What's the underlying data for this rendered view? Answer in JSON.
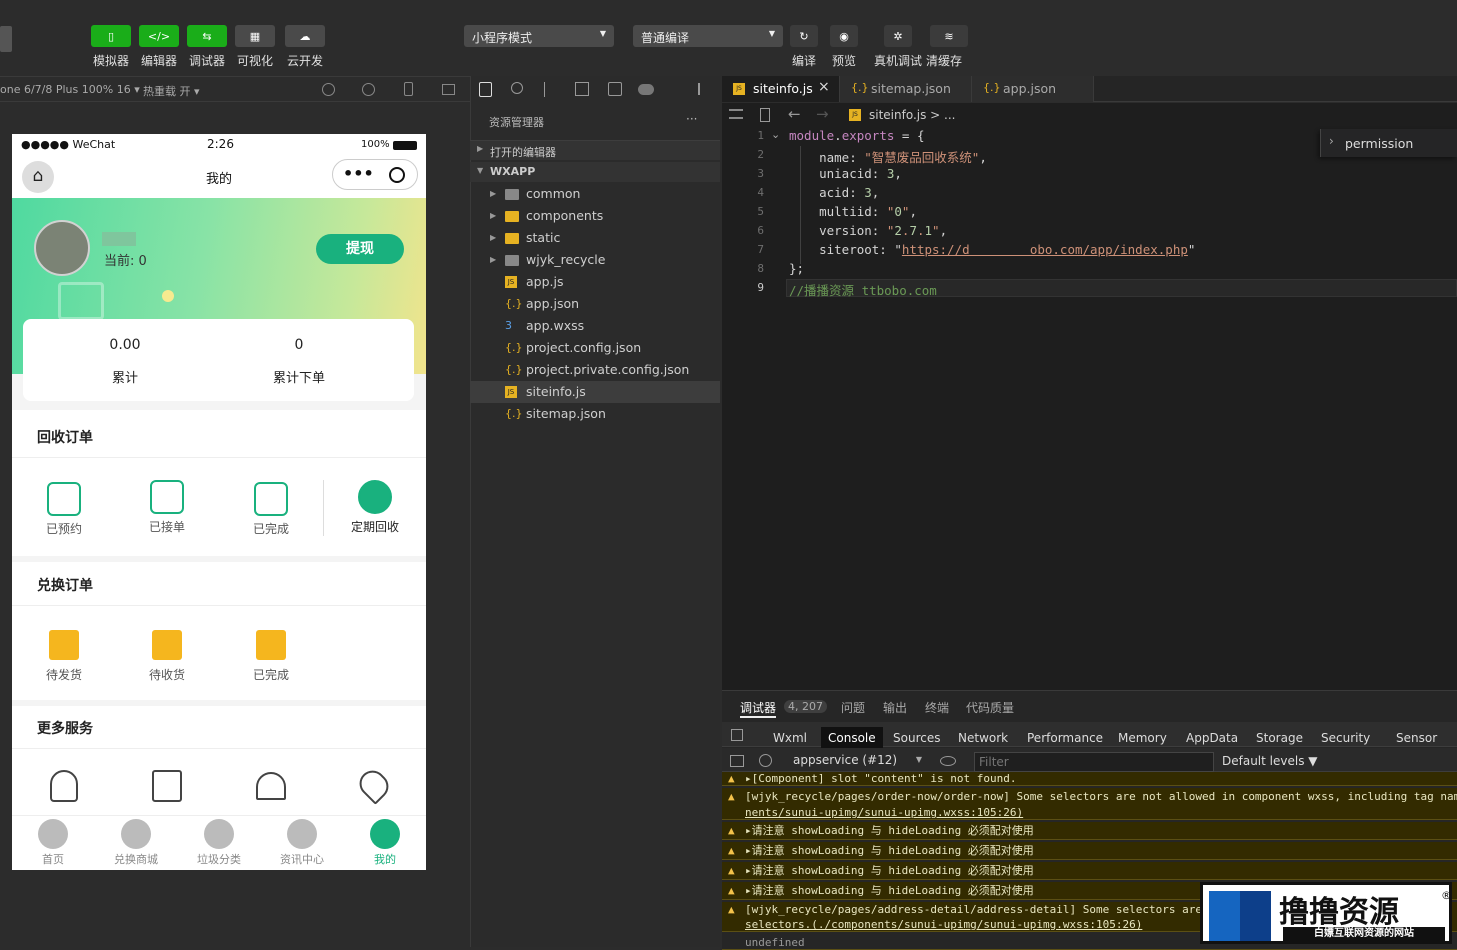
{
  "toolbar": {
    "buttons": [
      {
        "label": "模拟器",
        "glyph": "▯",
        "active": true
      },
      {
        "label": "编辑器",
        "glyph": "</>",
        "active": true
      },
      {
        "label": "调试器",
        "glyph": "⇆",
        "active": true
      },
      {
        "label": "可视化",
        "glyph": "▦",
        "active": false
      },
      {
        "label": "云开发",
        "glyph": "☁",
        "active": false
      }
    ],
    "mode_select": "小程序模式",
    "compile_select": "普通编译",
    "right_buttons": [
      {
        "label": "编译",
        "glyph": "↻"
      },
      {
        "label": "预览",
        "glyph": "◉"
      },
      {
        "label": "真机调试",
        "glyph": "✲"
      },
      {
        "label": "清缓存",
        "glyph": "≋"
      }
    ]
  },
  "sim_bar": {
    "device": "one 6/7/8 Plus 100% 16 ▾",
    "hotreload": "热重载 开 ▾"
  },
  "phone": {
    "carrier": "●●●●● WeChat",
    "time": "2:26",
    "battery": "100%",
    "page_title": "我的",
    "current": "当前: 0",
    "withdraw": "提现",
    "stats": [
      {
        "value": "0.00",
        "label": "累计"
      },
      {
        "value": "0",
        "label": "累计下单"
      }
    ],
    "recycle_title": "回收订单",
    "recycle_items": [
      "已预约",
      "已接单",
      "已完成",
      "定期回收"
    ],
    "exchange_title": "兑换订单",
    "exchange_items": [
      "待发货",
      "待收货",
      "已完成"
    ],
    "more_title": "更多服务",
    "tabs": [
      "首页",
      "兑换商城",
      "垃圾分类",
      "资讯中心",
      "我的"
    ]
  },
  "explorer": {
    "title": "资源管理器",
    "open_editors": "打开的编辑器",
    "root": "WXAPP",
    "items": [
      {
        "name": "common",
        "type": "folder"
      },
      {
        "name": "components",
        "type": "folder"
      },
      {
        "name": "static",
        "type": "folder"
      },
      {
        "name": "wjyk_recycle",
        "type": "folder"
      },
      {
        "name": "app.js",
        "type": "js"
      },
      {
        "name": "app.json",
        "type": "json"
      },
      {
        "name": "app.wxss",
        "type": "css"
      },
      {
        "name": "project.config.json",
        "type": "json"
      },
      {
        "name": "project.private.config.json",
        "type": "json"
      },
      {
        "name": "siteinfo.js",
        "type": "js",
        "selected": true
      },
      {
        "name": "sitemap.json",
        "type": "json"
      }
    ]
  },
  "editor": {
    "tabs": [
      {
        "label": "siteinfo.js",
        "active": true
      },
      {
        "label": "sitemap.json"
      },
      {
        "label": "app.json"
      }
    ],
    "breadcrumb": "siteinfo.js > ...",
    "outline": "permission",
    "lines": [
      "module.exports = {",
      "    name: \"智慧废品回收系统\",",
      "    uniacid: 3,",
      "    acid: 3,",
      "    multiid: \"0\",",
      "    version: \"2.7.1\",",
      "    siteroot: \"https://d        obo.com/app/index.php\"",
      "};",
      "//播播资源 ttbobo.com"
    ]
  },
  "debug": {
    "top_tabs": [
      "调试器",
      "4, 207",
      "问题",
      "输出",
      "终端",
      "代码质量"
    ],
    "tabs": [
      "Wxml",
      "Console",
      "Sources",
      "Network",
      "Performance",
      "Memory",
      "AppData",
      "Storage",
      "Security",
      "Sensor"
    ],
    "context": "appservice (#12)",
    "filter_placeholder": "Filter",
    "levels": "Default levels ▼",
    "logs": [
      "▸[Component] slot \"content\" is not found.",
      "[wjyk_recycle/pages/order-now/order-now] Some selectors are not allowed in component wxss, including tag nam",
      "nents/sunui-upimg/sunui-upimg.wxss:105:26)",
      "▸请注意 showLoading 与 hideLoading 必须配对使用",
      "▸请注意 showLoading 与 hideLoading 必须配对使用",
      "▸请注意 showLoading 与 hideLoading 必须配对使用",
      "▸请注意 showLoading 与 hideLoading 必须配对使用",
      "[wjyk_recycle/pages/address-detail/address-detail] Some selectors are",
      "selectors.(./components/sunui-upimg/sunui-upimg.wxss:105:26)",
      "undefined"
    ]
  },
  "watermark": {
    "title": "撸撸资源",
    "sub": "白嫖互联网资源的网站"
  }
}
